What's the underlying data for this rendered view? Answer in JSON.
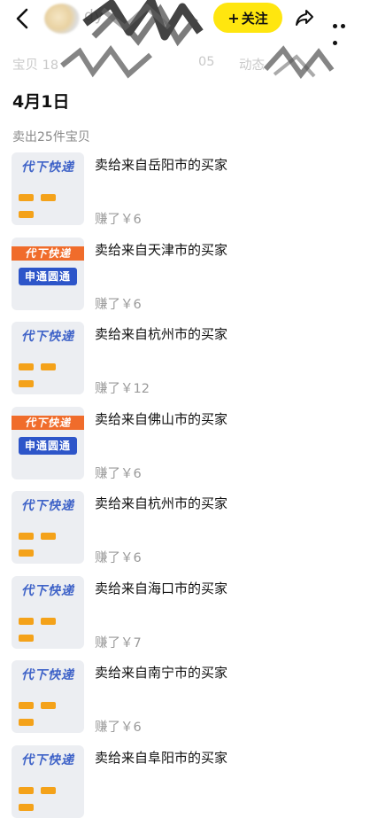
{
  "header": {
    "username": "dy",
    "follow_label": "关注",
    "follow_plus": "+"
  },
  "stats": [
    {
      "label": "宝贝 18"
    },
    {
      "label": "05"
    },
    {
      "label": "动态"
    }
  ],
  "date": "4月1日",
  "sold_summary": "卖出25件宝贝",
  "thumb_text": {
    "v1_title": "代下快递",
    "v2_band": "代下快递",
    "v2_box": "申通圆通"
  },
  "items": [
    {
      "title": "卖给来自岳阳市的买家",
      "earned": "赚了￥6",
      "thumb": "v1"
    },
    {
      "title": "卖给来自天津市的买家",
      "earned": "赚了￥6",
      "thumb": "v2"
    },
    {
      "title": "卖给来自杭州市的买家",
      "earned": "赚了￥12",
      "thumb": "v1"
    },
    {
      "title": "卖给来自佛山市的买家",
      "earned": "赚了￥6",
      "thumb": "v2"
    },
    {
      "title": "卖给来自杭州市的买家",
      "earned": "赚了￥6",
      "thumb": "v1"
    },
    {
      "title": "卖给来自海口市的买家",
      "earned": "赚了￥7",
      "thumb": "v1"
    },
    {
      "title": "卖给来自南宁市的买家",
      "earned": "赚了￥6",
      "thumb": "v1"
    },
    {
      "title": "卖给来自阜阳市的买家",
      "earned": "",
      "thumb": "v1"
    }
  ],
  "colors": {
    "follow_bg": "#ffe60f",
    "accent_orange": "#f06c2b",
    "accent_blue": "#2d55c9"
  },
  "icons": [
    "back-arrow-icon",
    "share-icon",
    "more-icon"
  ]
}
